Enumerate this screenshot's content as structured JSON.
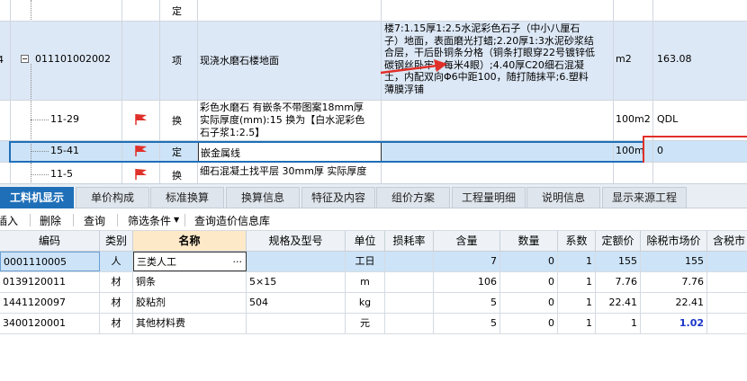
{
  "top_grid": {
    "rows": [
      {
        "type": "定",
        "code": "",
        "name": "",
        "desc": "",
        "unit": "",
        "qty": ""
      },
      {
        "rownum": "4",
        "code": "011101002002",
        "type": "项",
        "name": "现浇水磨石楼地面",
        "desc_lines": [
          "楼7:1.15厚1:2.5水泥彩色石子（中小八厘石",
          "子）地面，表面磨光打蜡;2.20厚1:3水泥砂浆结",
          "合层，干后卧铜条分格（铜条打眼穿22号镀锌低",
          "碳钢丝卧牢，每米4眼）;4.40厚C20细石混凝",
          "土，内配双向Φ6中距100，随打随抹平;6.塑料",
          "薄膜浮铺"
        ],
        "unit": "m2",
        "qty": "163.08"
      },
      {
        "code": "11-29",
        "type": "换",
        "name_lines": [
          "彩色水磨石 有嵌条不带图案18mm厚",
          "实际厚度(mm):15  换为【白水泥彩色",
          "石子浆1:2.5】"
        ],
        "unit": "100m2",
        "qty": "QDL"
      },
      {
        "code": "15-41",
        "type": "定",
        "name": "嵌金属线",
        "unit": "100m",
        "qty": "0"
      },
      {
        "code": "11-5",
        "type": "换",
        "name": "细石混凝土找平层 30mm厚  实际厚度"
      }
    ]
  },
  "tabs": [
    "工料机显示",
    "单价构成",
    "标准换算",
    "换算信息",
    "特征及内容",
    "组价方案",
    "工程量明细",
    "说明信息",
    "显示来源工程"
  ],
  "toolbar": {
    "insert": "插入",
    "delete": "删除",
    "query": "查询",
    "filter": "筛选条件",
    "query_db": "查询造价信息库"
  },
  "lower_grid": {
    "headers": [
      "编码",
      "类别",
      "名称",
      "规格及型号",
      "单位",
      "损耗率",
      "含量",
      "数量",
      "系数",
      "定额价",
      "除税市场价",
      "含税市"
    ],
    "rows": [
      {
        "code": "0001110005",
        "cat": "人",
        "name": "三类人工",
        "spec": "",
        "unit": "工日",
        "loss": "",
        "content": "7",
        "qty": "0",
        "coef": "1",
        "quota": "155",
        "market": "155"
      },
      {
        "code": "0139120011",
        "cat": "材",
        "name": "铜条",
        "spec": "5×15",
        "unit": "m",
        "loss": "",
        "content": "106",
        "qty": "0",
        "coef": "1",
        "quota": "7.76",
        "market": "7.76"
      },
      {
        "code": "1441120097",
        "cat": "材",
        "name": "胶粘剂",
        "spec": "504",
        "unit": "kg",
        "loss": "",
        "content": "5",
        "qty": "0",
        "coef": "1",
        "quota": "22.41",
        "market": "22.41"
      },
      {
        "code": "3400120001",
        "cat": "材",
        "name": "其他材料费",
        "spec": "",
        "unit": "元",
        "loss": "",
        "content": "5",
        "qty": "0",
        "coef": "1",
        "quota": "1",
        "market": "1.02"
      }
    ]
  },
  "colors": {
    "accent": "#1f6fb8",
    "selected_row": "#cde3f7",
    "highlight_box": "#e0302a",
    "flag": "#e0302a",
    "market_blue": "#1a36c8"
  }
}
